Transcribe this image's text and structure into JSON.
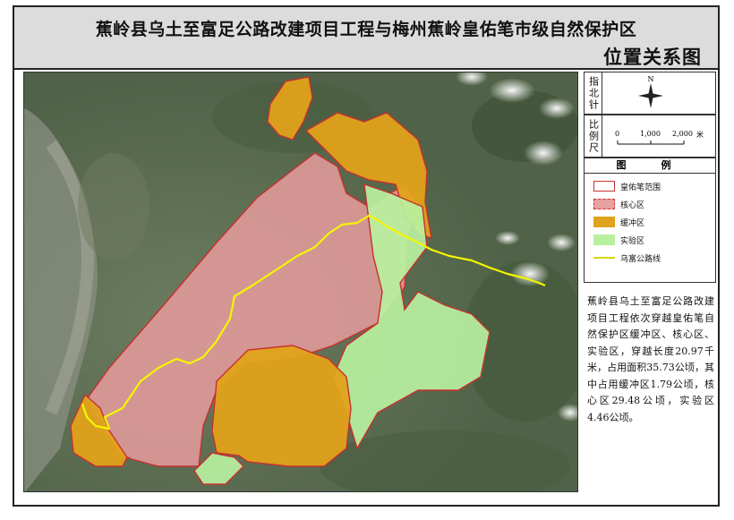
{
  "title": {
    "line1": "蕉岭县乌土至富足公路改建项目工程与梅州蕉岭皇佑笔市级自然保护区",
    "line2": "位置关系图"
  },
  "north_arrow": {
    "label": "指北针",
    "letter": "N"
  },
  "scale_bar": {
    "label": "比例尺",
    "ticks": [
      "0",
      "1,000",
      "2,000"
    ],
    "unit": "米"
  },
  "legend": {
    "title": "图　例",
    "items": [
      {
        "label": "皇佑笔范围",
        "color": "#cc3333",
        "style": "outline"
      },
      {
        "label": "核心区",
        "color": "#e8a0a0",
        "style": "fill"
      },
      {
        "label": "缓冲区",
        "color": "#e0a21a",
        "style": "fill"
      },
      {
        "label": "实验区",
        "color": "#b8f0a0",
        "style": "fill"
      },
      {
        "label": "乌富公路线",
        "color": "#f5f500",
        "style": "line"
      }
    ]
  },
  "note": "蕉岭县乌土至富足公路改建项目工程依次穿越皇佑笔自然保护区缓冲区、核心区、实验区，穿越长度20.97千米，占用面积35.73公顷，其中占用缓冲区1.79公顷，核心区29.48公顷，实验区4.46公顷。",
  "colors": {
    "boundary": "#cc3333",
    "core": "#e8a0a0",
    "buffer": "#e0a21a",
    "experimental": "#b8f0a0",
    "road": "#f5f500"
  }
}
